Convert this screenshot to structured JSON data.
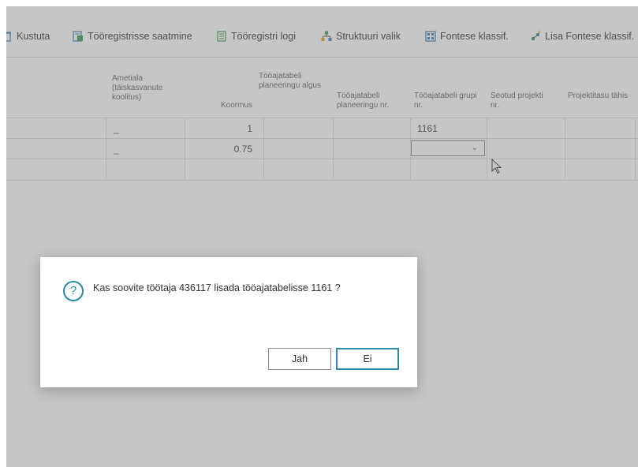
{
  "actions": {
    "kustuta": "Kustuta",
    "saatmine": "Tööregistrisse saatmine",
    "logi": "Tööregistri logi",
    "struktuur": "Struktuuri valik",
    "fontese": "Fontese klassif.",
    "lisa": "Lisa Fontese klassif."
  },
  "headers": {
    "ametiala": "Ametiala (täiskasvanute koolitus)",
    "koormus": "Koormus",
    "algus": "Tööajatabeli planeeringu algus",
    "planeeringu_nr": "Tööajatabeli planeeringu nr.",
    "grupi_nr": "Tööajatabeli grupi nr.",
    "seotud": "Seotud projekti nr.",
    "projektitasu": "Projektitasu tähis"
  },
  "rows": [
    {
      "ametiala": "_",
      "koormus": "1",
      "grupi_nr": "1161"
    },
    {
      "ametiala": "_",
      "koormus": "0.75",
      "grupi_nr": ""
    },
    {
      "ametiala": "",
      "koormus": "",
      "grupi_nr": ""
    }
  ],
  "dialog": {
    "message": "Kas soovite töötaja 436117 lisada tööajatabelisse 1161 ?",
    "yes": "Jah",
    "no": "Ei",
    "icon": "question-icon"
  },
  "colors": {
    "accent": "#2b88a8",
    "overlay": "rgba(120,120,120,0.42)"
  }
}
